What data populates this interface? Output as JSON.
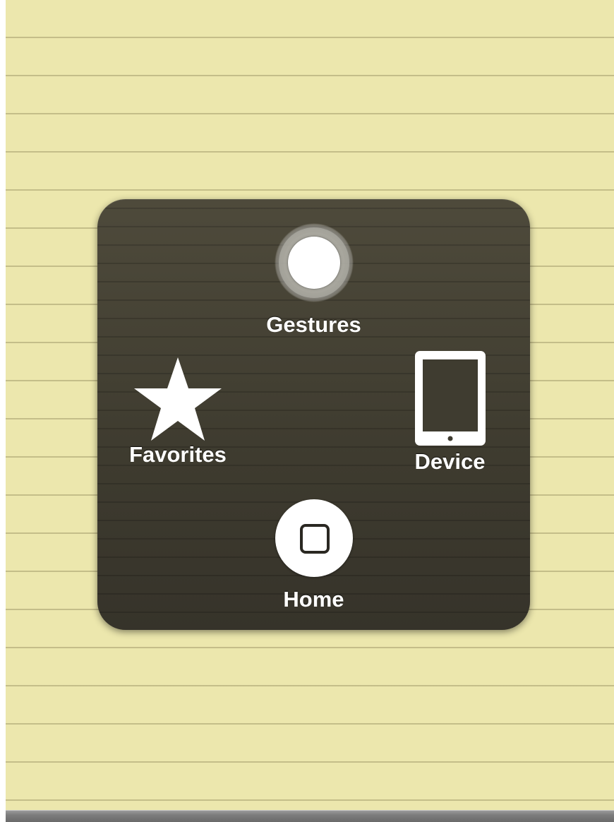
{
  "menu": {
    "gestures": {
      "label": "Gestures",
      "icon": "gestures-circle-icon"
    },
    "favorites": {
      "label": "Favorites",
      "icon": "star-icon"
    },
    "device": {
      "label": "Device",
      "icon": "tablet-icon"
    },
    "home": {
      "label": "Home",
      "icon": "home-button-icon"
    }
  },
  "colors": {
    "notepad": "#ece7ad",
    "panel": "#3f3c30",
    "label": "#ffffff"
  }
}
